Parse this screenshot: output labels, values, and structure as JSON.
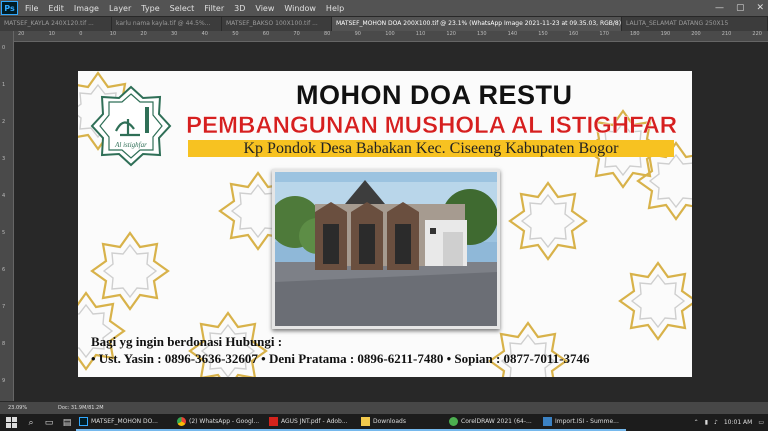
{
  "app": {
    "logo_text": "Ps"
  },
  "menu": [
    "File",
    "Edit",
    "Image",
    "Layer",
    "Type",
    "Select",
    "Filter",
    "3D",
    "View",
    "Window",
    "Help"
  ],
  "window_controls": [
    "—",
    "▢",
    "✕"
  ],
  "tabs": [
    {
      "label": "MATSEF_KAYLA 240X120.tif ...",
      "active": false
    },
    {
      "label": "karlu nama kayla.tif @ 44.5%...",
      "active": false
    },
    {
      "label": "MATSEF_BAKSO 100X100.tif ...",
      "active": false
    },
    {
      "label": "MATSEF_MOHON DOA 200X100.tif @ 23.1% (WhatsApp Image 2021-11-23 at 09.35.03, RGB/8)",
      "active": true
    },
    {
      "label": "LALITA_SELAMAT DATANG 250X15",
      "active": false
    }
  ],
  "ruler_top": [
    "20",
    "10",
    "0",
    "10",
    "20",
    "30",
    "40",
    "50",
    "60",
    "70",
    "80",
    "90",
    "100",
    "110",
    "120",
    "130",
    "140",
    "150",
    "160",
    "170",
    "180",
    "190",
    "200",
    "210",
    "220"
  ],
  "ruler_left": [
    "0",
    "1",
    "2",
    "3",
    "4",
    "5",
    "6",
    "7",
    "8",
    "9"
  ],
  "banner": {
    "title": "MOHON DOA RESTU",
    "subtitle": "PEMBANGUNAN MUSHOLA AL ISTIGHFAR",
    "address": "Kp Pondok Desa Babakan Kec. Ciseeng Kabupaten Bogor",
    "logo_caption": "Al istighfar",
    "donate_line": "Bagi yg ingin berdonasi Hubungi :",
    "contacts": "• Ust. Yasin : 0896-3636-32607 • Deni Pratama :  0896-6211-7480 • Sopian : 0877-7011-3746"
  },
  "status": {
    "zoom": "23.09%",
    "doc": "Doc: 31.9M/81.2M"
  },
  "taskbar": {
    "apps": [
      {
        "label": "MATSEF_MOHON DO...",
        "icon": "photoshop-icon"
      },
      {
        "label": "(2) WhatsApp - Googl...",
        "icon": "chrome-icon"
      },
      {
        "label": "AGUS JNT.pdf - Adob...",
        "icon": "acrobat-icon"
      },
      {
        "label": "Downloads",
        "icon": "folder-icon"
      },
      {
        "label": "CorelDRAW 2021 (64-...",
        "icon": "coreldraw-icon"
      },
      {
        "label": "Import.ISI - Summe...",
        "icon": "editor-icon"
      }
    ],
    "clock": "10:01 AM"
  }
}
